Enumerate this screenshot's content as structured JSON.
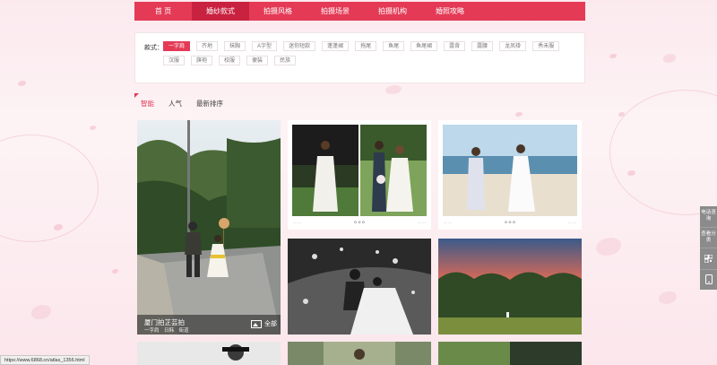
{
  "nav": {
    "items": [
      "首 页",
      "婚纱款式",
      "拍摄风格",
      "拍摄场景",
      "拍摄机构",
      "婚照攻略"
    ],
    "active_index": 1
  },
  "filter": {
    "label": "款式：",
    "tags": [
      "一字肩",
      "齐地",
      "抹胸",
      "A字型",
      "迷你短款",
      "蓬蓬裙",
      "拖尾",
      "鱼尾",
      "鱼尾裙",
      "露背",
      "露腰",
      "龙凤褂",
      "秀禾服",
      "汉服",
      "旗袍",
      "校服",
      "便装",
      "民族"
    ],
    "active_index": 0
  },
  "sort": {
    "items": [
      "智能",
      "人气",
      "最新排序"
    ],
    "active_index": 0
  },
  "featured": {
    "title": "厦门拍芷芸拍",
    "tags": "一字肩　日韩　街道",
    "all_label": "全部"
  },
  "side_panel": {
    "contact": "电话咨询",
    "categories": "查看分类"
  },
  "status_bar": {
    "url": "https://www.6868.cn/atlas_1356.html"
  },
  "colors": {
    "brand": "#e43a56",
    "nav_active": "#c92240"
  },
  "icons": [
    "qrcode-icon",
    "mobile-icon",
    "photo-icon"
  ]
}
